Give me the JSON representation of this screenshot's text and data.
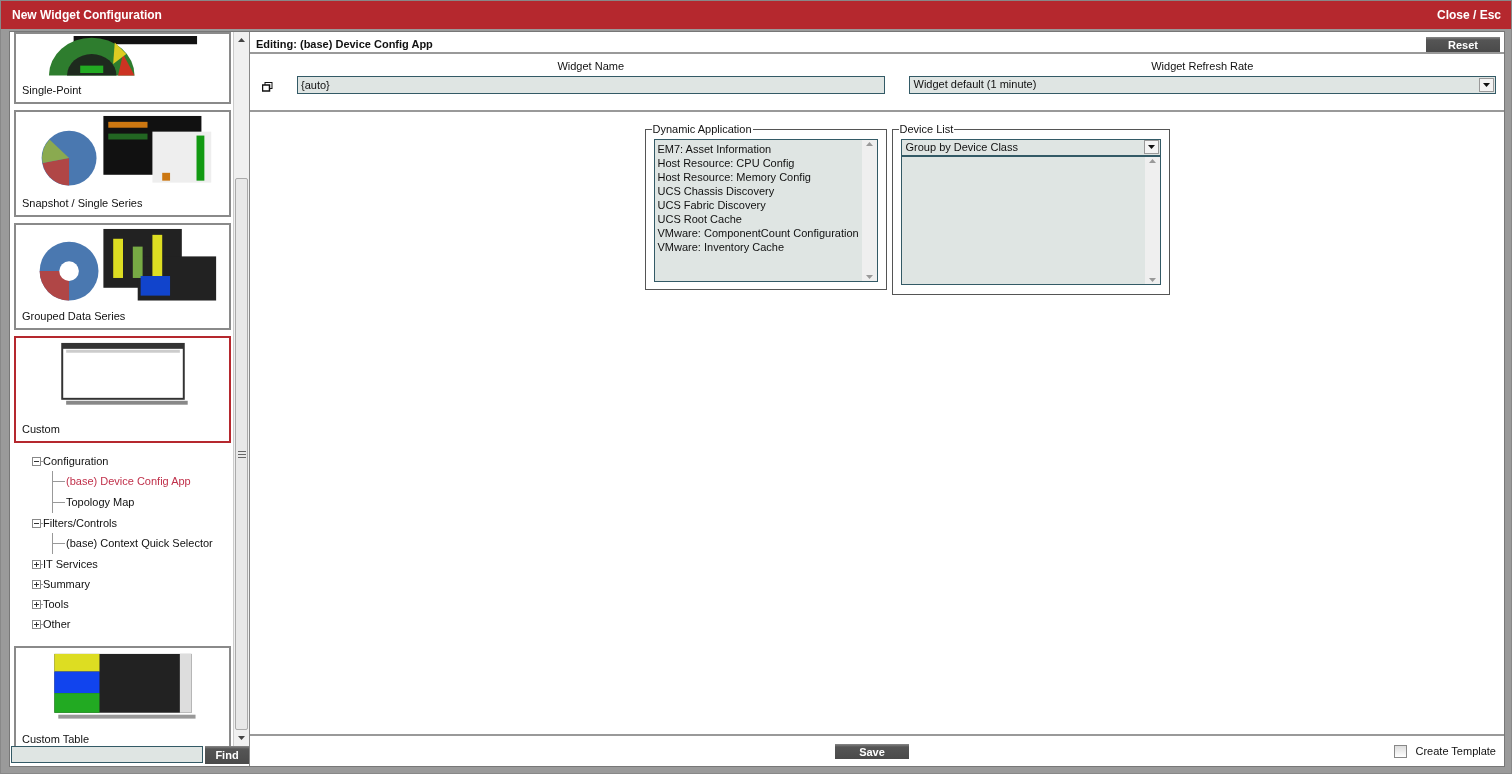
{
  "window": {
    "title": "New Widget Configuration",
    "close": "Close / Esc"
  },
  "sidebar": {
    "widget_types": [
      {
        "label": "Single-Point",
        "selected": false
      },
      {
        "label": "Snapshot / Single Series",
        "selected": false
      },
      {
        "label": "Grouped Data Series",
        "selected": false
      },
      {
        "label": "Custom",
        "selected": true,
        "tree": [
          {
            "label": "Configuration",
            "expanded": true,
            "children": [
              {
                "label": "(base) Device Config App",
                "selected": true
              },
              {
                "label": "Topology Map",
                "selected": false
              }
            ]
          },
          {
            "label": "Filters/Controls",
            "expanded": true,
            "children": [
              {
                "label": "(base) Context Quick Selector",
                "selected": false
              }
            ]
          },
          {
            "label": "IT Services",
            "expanded": false
          },
          {
            "label": "Summary",
            "expanded": false
          },
          {
            "label": "Tools",
            "expanded": false
          },
          {
            "label": "Other",
            "expanded": false
          }
        ]
      },
      {
        "label": "Custom Table",
        "selected": false
      }
    ],
    "find_button": "Find"
  },
  "editor": {
    "title": "Editing: (base) Device Config App",
    "reset_button": "Reset",
    "widget_name": {
      "label": "Widget Name",
      "value": "{auto}"
    },
    "refresh_rate": {
      "label": "Widget Refresh Rate",
      "value": "Widget default (1 minute)"
    },
    "dynamic_application": {
      "legend": "Dynamic Application",
      "items": [
        "EM7: Asset Information",
        "Host Resource: CPU Config",
        "Host Resource: Memory Config",
        "UCS Chassis Discovery",
        "UCS Fabric Discovery",
        "UCS Root Cache",
        "VMware: ComponentCount Configuration",
        "VMware: Inventory Cache"
      ]
    },
    "device_list": {
      "legend": "Device List",
      "value": "Group by Device Class"
    },
    "save_button": "Save",
    "create_template": {
      "label": "Create Template",
      "checked": false
    }
  }
}
